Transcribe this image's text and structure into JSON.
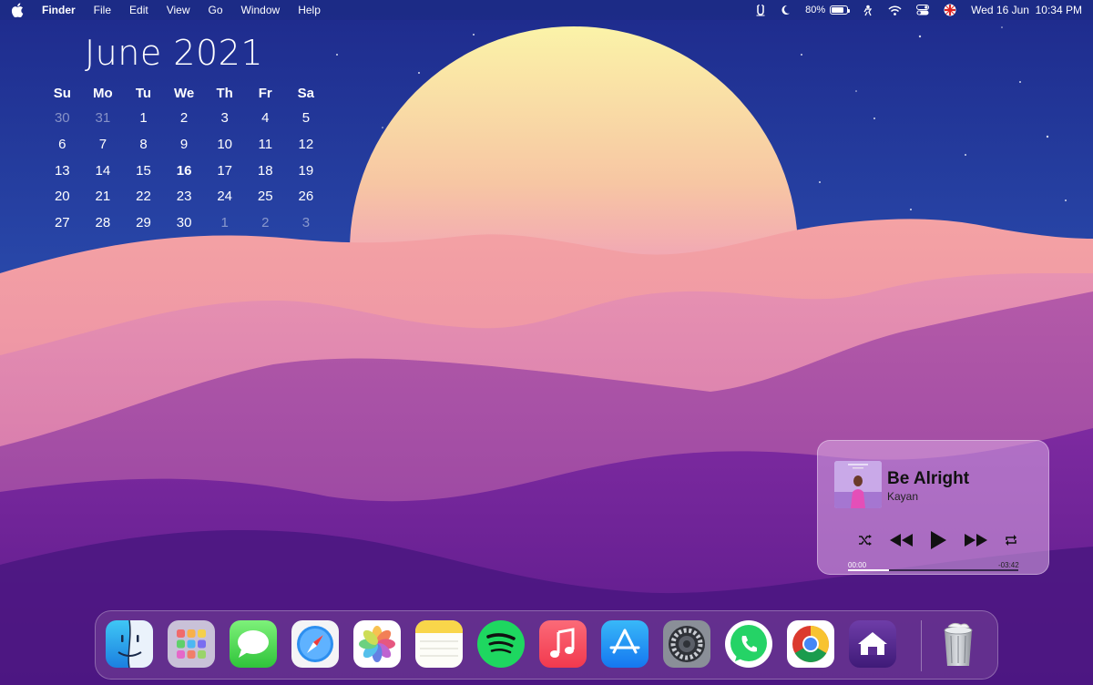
{
  "menubar": {
    "apple_icon": "apple-logo-icon",
    "app_name": "Finder",
    "menus": [
      "File",
      "Edit",
      "View",
      "Go",
      "Window",
      "Help"
    ],
    "status_icons": [
      "u-status-icon",
      "moon-icon"
    ],
    "battery_percent": "80%",
    "battery_level": 0.8,
    "extra_icons": [
      "app-status-icon",
      "wifi-icon",
      "control-center-icon",
      "flag-icon"
    ],
    "clock": "Wed 16 Jun  10:34 PM"
  },
  "calendar": {
    "title": "June 2021",
    "weekdays": [
      "Su",
      "Mo",
      "Tu",
      "We",
      "Th",
      "Fr",
      "Sa"
    ],
    "weeks": [
      [
        "30",
        "31",
        "1",
        "2",
        "3",
        "4",
        "5"
      ],
      [
        "6",
        "7",
        "8",
        "9",
        "10",
        "11",
        "12"
      ],
      [
        "13",
        "14",
        "15",
        "16",
        "17",
        "18",
        "19"
      ],
      [
        "20",
        "21",
        "22",
        "23",
        "24",
        "25",
        "26"
      ],
      [
        "27",
        "28",
        "29",
        "30",
        "1",
        "2",
        "3"
      ]
    ],
    "today": "16"
  },
  "music": {
    "title": "Be Alright",
    "artist": "Kayan",
    "elapsed": "00:00",
    "remaining": "-03:42",
    "progress": 0.24,
    "icons": [
      "shuffle-icon",
      "rewind-icon",
      "play-icon",
      "fast-forward-icon",
      "repeat-icon"
    ]
  },
  "dock": {
    "apps": [
      "finder-icon",
      "launchpad-icon",
      "messages-icon",
      "safari-icon",
      "photos-icon",
      "notes-icon",
      "spotify-icon",
      "music-icon",
      "app-store-icon",
      "system-preferences-icon",
      "whatsapp-icon",
      "chrome-icon",
      "home-app-icon",
      "trash-icon"
    ]
  }
}
